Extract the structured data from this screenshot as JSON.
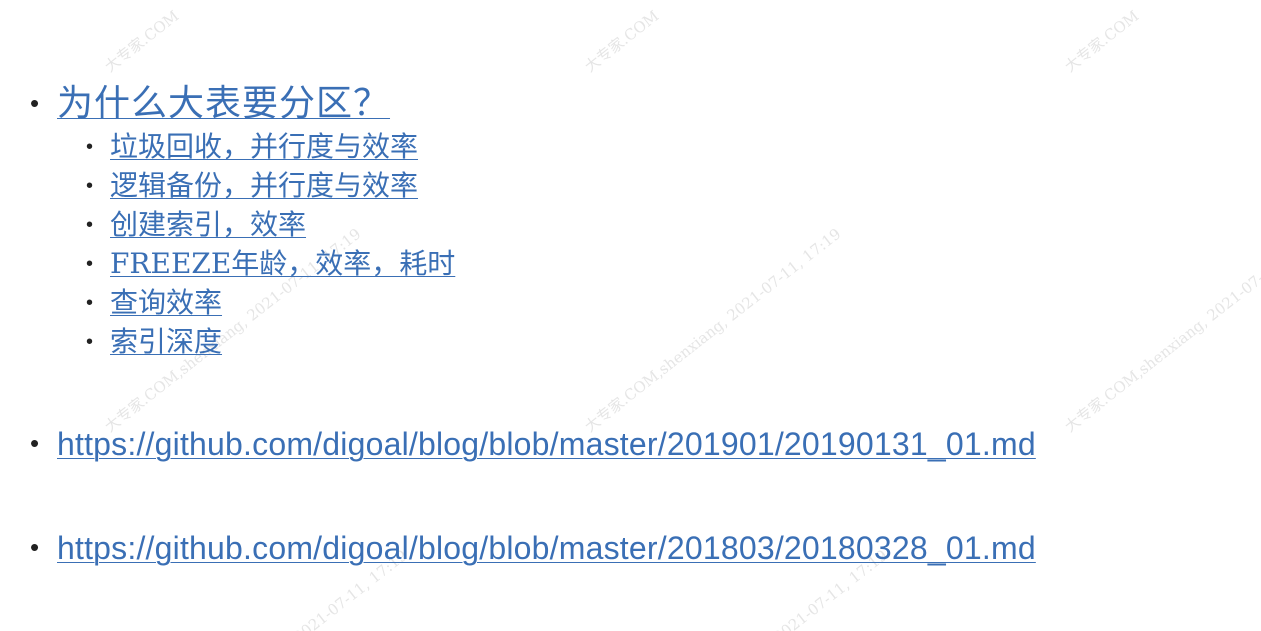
{
  "heading_item": "为什么大表要分区？",
  "sub_items": [
    "垃圾回收，并行度与效率",
    "逻辑备份，并行度与效率",
    "创建索引，效率",
    "FREEZE年龄，效率，耗时",
    "查询效率",
    "索引深度"
  ],
  "links": [
    "https://github.com/digoal/blog/blob/master/201901/20190131_01.md",
    "https://github.com/digoal/blog/blob/master/201803/20180328_01.md"
  ],
  "watermarks": {
    "brand": "大专家.COM",
    "full": "大专家.COM,shenxiang, 2021-07-11, 17:19",
    "date": "2021-07-11, 17:19"
  },
  "colors": {
    "link": "#3a6fb5",
    "bullet": "#222222",
    "watermark": "#a0a0a0"
  }
}
